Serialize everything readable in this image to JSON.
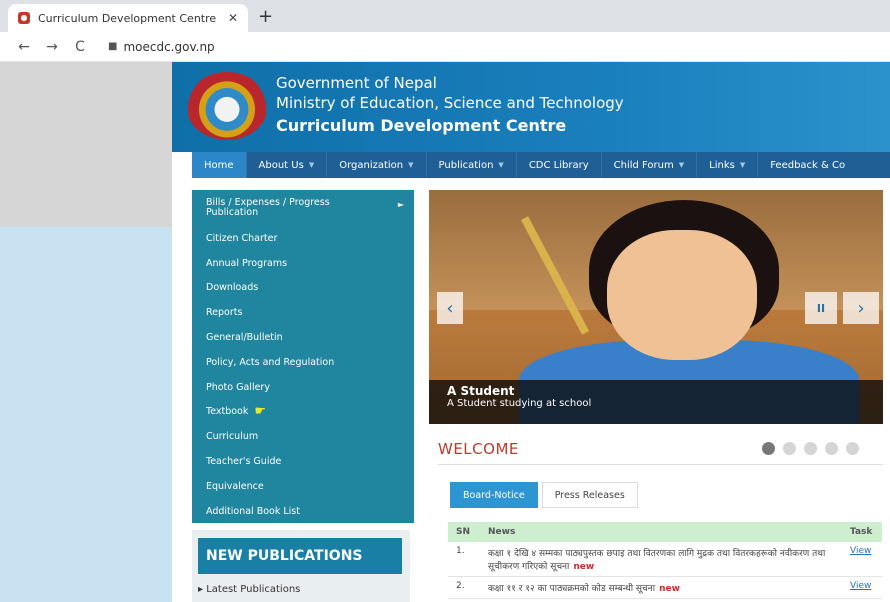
{
  "browser": {
    "tab_title": "Curriculum Development Centre",
    "tab_close": "✕",
    "new_tab": "+",
    "back": "←",
    "forward": "→",
    "reload": "C",
    "url": "moecdc.gov.np"
  },
  "header": {
    "line1": "Government of Nepal",
    "line2": "Ministry of Education, Science and Technology",
    "line3": "Curriculum Development Centre"
  },
  "nav": {
    "items": [
      {
        "label": "Home",
        "has_caret": false
      },
      {
        "label": "About Us",
        "has_caret": true
      },
      {
        "label": "Organization",
        "has_caret": true
      },
      {
        "label": "Publication",
        "has_caret": true
      },
      {
        "label": "CDC Library",
        "has_caret": false
      },
      {
        "label": "Child Forum",
        "has_caret": true
      },
      {
        "label": "Links",
        "has_caret": true
      },
      {
        "label": "Feedback & Co",
        "has_caret": false
      }
    ]
  },
  "side_menu": {
    "items": [
      "Bills / Expenses / Progress Publication",
      "Citizen Charter",
      "Annual Programs",
      "Downloads",
      "Reports",
      "General/Bulletin",
      "Policy, Acts and Regulation",
      "Photo Gallery",
      "Textbook",
      "Curriculum",
      "Teacher's Guide",
      "Equivalence",
      "Additional Book List"
    ]
  },
  "new_publications": {
    "heading": "NEW PUBLICATIONS",
    "latest": "Latest Publications"
  },
  "slider": {
    "caption_title": "A Student",
    "caption_sub": "A Student studying at school",
    "prev": "‹",
    "pause": "II",
    "next": "›"
  },
  "welcome": "WELCOME",
  "tabs": {
    "board_notice": "Board-Notice",
    "press_releases": "Press Releases"
  },
  "notice_table": {
    "headers": {
      "sn": "SN",
      "news": "News",
      "task": "Task"
    },
    "rows": [
      {
        "sn": "1.",
        "news": "कक्षा १ देखि ४ सम्मका पाठ्यपुस्तक छपाइ तथा वितरणका लागि मुद्रक तथा वितरकहरूको नवीकरण तथा सूचीकरण गरिएको सूचना",
        "new": "new",
        "task": "View"
      },
      {
        "sn": "2.",
        "news": "कक्षा ११ र १२ का पाठ्यक्रमको कोड सम्बन्धी सूचना",
        "new": "new",
        "task": "View"
      }
    ]
  },
  "colors": {
    "header_blue": "#0f6fa8",
    "nav_blue": "#1f5f95",
    "menu_teal": "#20869f",
    "welcome_red": "#c0392b",
    "table_head_green": "#cdeecf"
  }
}
